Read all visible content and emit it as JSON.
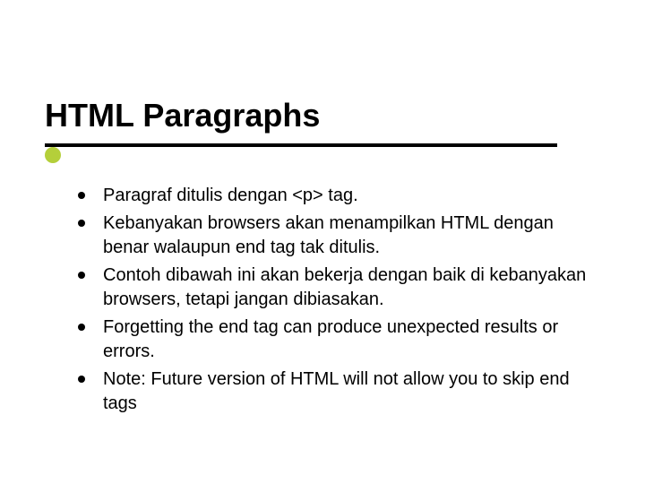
{
  "title": "HTML Paragraphs",
  "bullets": [
    "Paragraf ditulis dengan <p> tag.",
    "Kebanyakan browsers akan menampilkan HTML dengan benar walaupun end tag tak ditulis.",
    "Contoh dibawah ini akan bekerja dengan baik di kebanyakan browsers, tetapi jangan dibiasakan.",
    "Forgetting the end tag can produce unexpected results or errors.",
    "Note: Future version of HTML will not allow you to skip end tags"
  ]
}
